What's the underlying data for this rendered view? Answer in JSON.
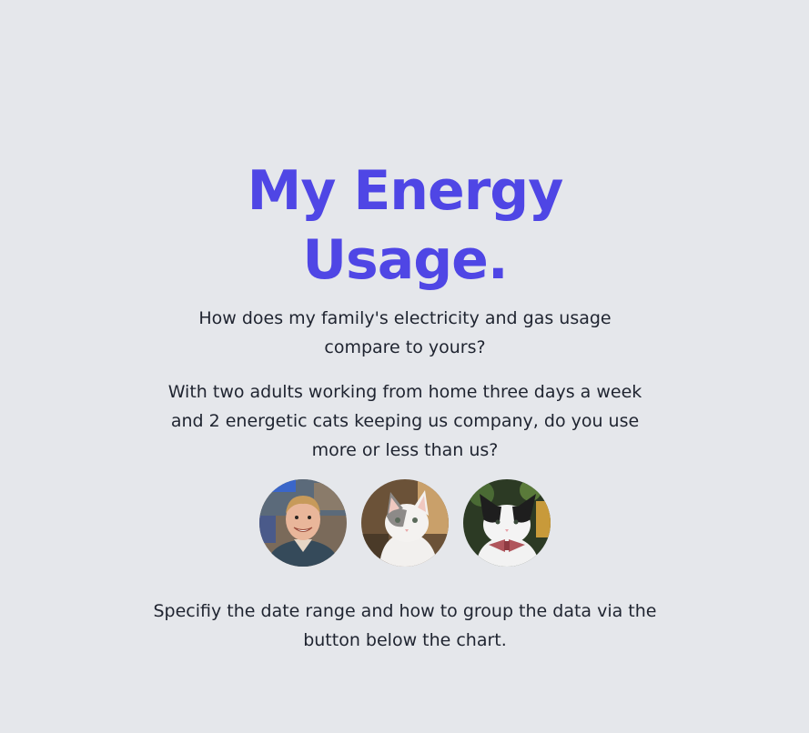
{
  "header": {
    "title": "My Energy Usage."
  },
  "intro": {
    "question": "How does my family's electricity and gas usage compare to yours?",
    "description": "With two adults working from home three days a week and 2 energetic cats keeping us company, do you use more or less than us?"
  },
  "family": {
    "avatars": [
      {
        "name": "person-avatar"
      },
      {
        "name": "cat-avatar-1"
      },
      {
        "name": "cat-avatar-2"
      }
    ]
  },
  "instructions": {
    "text": "Specifiy the date range and how to group the data via the button below the chart."
  },
  "colors": {
    "background": "#e5e7eb",
    "accent": "#4f46e5",
    "text": "#1f2430"
  }
}
